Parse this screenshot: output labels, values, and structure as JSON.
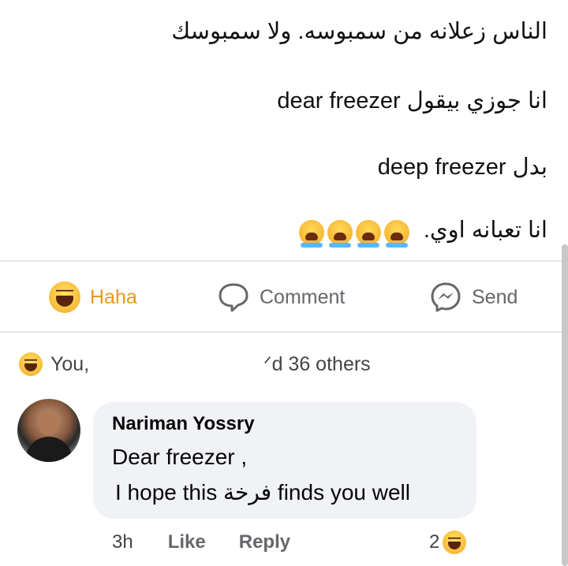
{
  "post": {
    "lines": [
      "الناس زعلانه من سمبوسه. ولا سمبوسك",
      "انا جوزي بيقول dear freezer",
      "بدل deep freezer",
      "انا تعبانه اوي."
    ],
    "crying_emoji_count": 4
  },
  "actions": {
    "haha_label": "Haha",
    "comment_label": "Comment",
    "send_label": "Send"
  },
  "reactions": {
    "you_label": "You,",
    "others_label": "ᐟd 36 others"
  },
  "comment": {
    "author": "Nariman Yossry",
    "line1": "Dear freezer  ,",
    "line2": "I hope this فرخة finds you well",
    "time": "3h",
    "like_label": "Like",
    "reply_label": "Reply",
    "reaction_count": "2"
  },
  "colors": {
    "haha_accent": "#e59a1c",
    "muted_text": "#65676b",
    "bubble_bg": "#f0f2f5",
    "divider": "#e4e6eb"
  }
}
